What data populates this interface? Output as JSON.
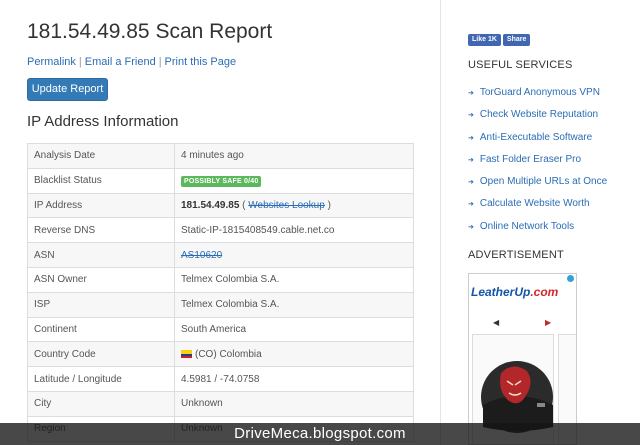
{
  "main": {
    "title": "181.54.49.85 Scan Report",
    "links": [
      "Permalink",
      "Email a Friend",
      "Print this Page"
    ],
    "update_button": "Update Report",
    "section_title": "IP Address Information",
    "rows": [
      {
        "label": "Analysis Date",
        "value": "4 minutes ago"
      },
      {
        "label": "Blacklist Status",
        "badge": "POSSIBLY SAFE 0/40"
      },
      {
        "label": "IP Address",
        "ip": "181.54.49.85",
        "open": " ( ",
        "link": "Websites Lookup",
        "close": " )"
      },
      {
        "label": "Reverse DNS",
        "value": "Static-IP-1815408549.cable.net.co"
      },
      {
        "label": "ASN",
        "link": "AS10620"
      },
      {
        "label": "ASN Owner",
        "value": "Telmex Colombia S.A."
      },
      {
        "label": "ISP",
        "value": "Telmex Colombia S.A."
      },
      {
        "label": "Continent",
        "value": "South America"
      },
      {
        "label": "Country Code",
        "flag": "colombia-flag",
        "value": "(CO) Colombia"
      },
      {
        "label": "Latitude / Longitude",
        "value": "4.5981 / -74.0758"
      },
      {
        "label": "City",
        "value": "Unknown"
      },
      {
        "label": "Region",
        "value": "Unknown"
      }
    ]
  },
  "sidebar": {
    "fb_like": "Like 1K",
    "fb_share": "Share",
    "useful_title": "USEFUL SERVICES",
    "services": [
      "TorGuard Anonymous VPN",
      "Check Website Reputation",
      "Anti-Executable Software",
      "Fast Folder Eraser Pro",
      "Open Multiple URLs at Once",
      "Calculate Website Worth",
      "Online Network Tools"
    ],
    "ad_title": "ADVERTISEMENT",
    "ad": {
      "brand_a": "LeatherUp",
      "brand_b": ".com",
      "prev": "◀",
      "next": "▶"
    }
  },
  "watermark": "DriveMeca.blogspot.com",
  "colors": {
    "link": "#2a6db5",
    "button": "#337ab7",
    "badge": "#5cb85c"
  }
}
